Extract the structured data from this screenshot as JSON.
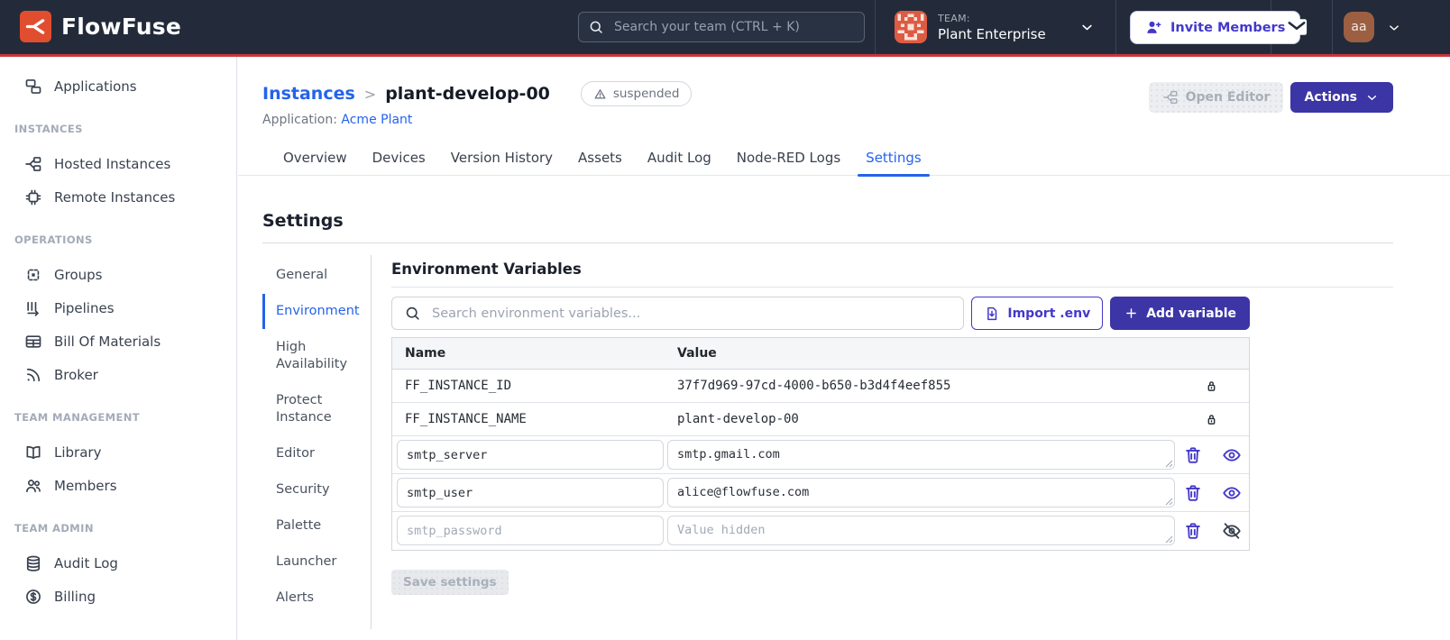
{
  "navbar": {
    "brand": "FlowFuse",
    "search_placeholder": "Search your team (CTRL + K)",
    "team_label": "TEAM:",
    "team_name": "Plant Enterprise",
    "invite_button": "Invite Members",
    "avatar_initials": "aa"
  },
  "sidebar": {
    "sections": [
      {
        "header": null,
        "items": [
          {
            "label": "Applications",
            "icon": "applications-icon"
          }
        ]
      },
      {
        "header": "INSTANCES",
        "items": [
          {
            "label": "Hosted Instances",
            "icon": "hosted-instances-icon"
          },
          {
            "label": "Remote Instances",
            "icon": "remote-instances-icon"
          }
        ]
      },
      {
        "header": "OPERATIONS",
        "items": [
          {
            "label": "Groups",
            "icon": "groups-icon"
          },
          {
            "label": "Pipelines",
            "icon": "pipelines-icon"
          },
          {
            "label": "Bill Of Materials",
            "icon": "bill-of-materials-icon"
          },
          {
            "label": "Broker",
            "icon": "broker-icon"
          }
        ]
      },
      {
        "header": "TEAM MANAGEMENT",
        "items": [
          {
            "label": "Library",
            "icon": "library-icon"
          },
          {
            "label": "Members",
            "icon": "members-icon"
          }
        ]
      },
      {
        "header": "TEAM ADMIN",
        "items": [
          {
            "label": "Audit Log",
            "icon": "audit-log-icon"
          },
          {
            "label": "Billing",
            "icon": "billing-icon"
          }
        ]
      }
    ]
  },
  "header": {
    "breadcrumb_parent": "Instances",
    "breadcrumb_separator": ">",
    "instance_name": "plant-develop-00",
    "status_badge": "suspended",
    "application_label": "Application:",
    "application_name": "Acme Plant",
    "open_editor_button": "Open Editor",
    "actions_button": "Actions"
  },
  "tabs": [
    {
      "label": "Overview",
      "active": false
    },
    {
      "label": "Devices",
      "active": false
    },
    {
      "label": "Version History",
      "active": false
    },
    {
      "label": "Assets",
      "active": false
    },
    {
      "label": "Audit Log",
      "active": false
    },
    {
      "label": "Node-RED Logs",
      "active": false
    },
    {
      "label": "Settings",
      "active": true
    }
  ],
  "settings": {
    "title": "Settings",
    "nav": [
      {
        "label": "General",
        "active": false
      },
      {
        "label": "Environment",
        "active": true
      },
      {
        "label": "High Availability",
        "active": false
      },
      {
        "label": "Protect Instance",
        "active": false
      },
      {
        "label": "Editor",
        "active": false
      },
      {
        "label": "Security",
        "active": false
      },
      {
        "label": "Palette",
        "active": false
      },
      {
        "label": "Launcher",
        "active": false
      },
      {
        "label": "Alerts",
        "active": false
      }
    ],
    "section_title": "Environment Variables",
    "search_placeholder": "Search environment variables...",
    "import_button": "Import .env",
    "add_button": "Add variable",
    "table": {
      "columns": [
        "Name",
        "Value"
      ],
      "locked_rows": [
        {
          "name": "FF_INSTANCE_ID",
          "value": "37f7d969-97cd-4000-b650-b3d4f4eef855"
        },
        {
          "name": "FF_INSTANCE_NAME",
          "value": "plant-develop-00"
        }
      ],
      "editable_rows": [
        {
          "name": "smtp_server",
          "value": "smtp.gmail.com",
          "hidden": false
        },
        {
          "name": "smtp_user",
          "value": "alice@flowfuse.com",
          "hidden": false
        },
        {
          "name_placeholder": "smtp_password",
          "value_placeholder": "Value hidden",
          "hidden": true
        }
      ]
    },
    "save_button": "Save settings"
  },
  "colors": {
    "navbar_bg": "#232B3A",
    "brand_red": "#C9353D",
    "brand_orange": "#E14E2F",
    "accent_blue": "#2563EB",
    "accent_indigo": "#3C35A5",
    "accent_indigo_text": "#4338CA",
    "avatar_bg": "#9D5F42"
  }
}
